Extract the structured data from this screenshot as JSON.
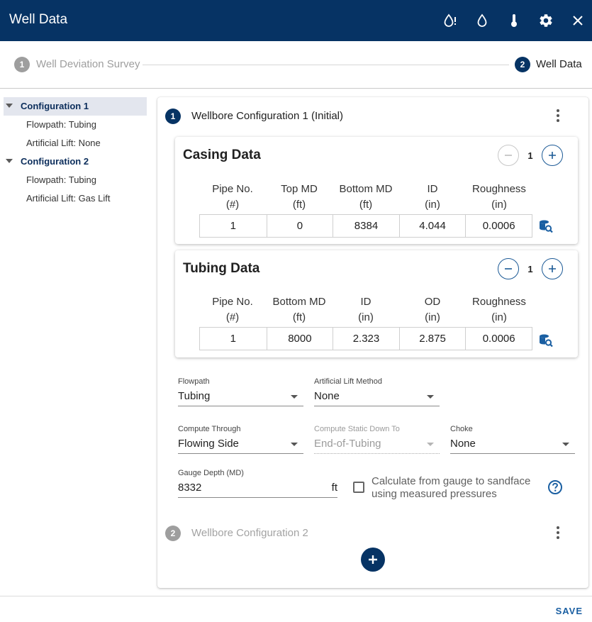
{
  "app": {
    "title": "Well Data",
    "header_icons": [
      "water-drop-alert-icon",
      "water-drop-icon",
      "thermometer-icon",
      "gear-icon",
      "close-icon"
    ]
  },
  "stepper": {
    "steps": [
      {
        "number": "1",
        "label": "Well Deviation Survey",
        "state": "inactive"
      },
      {
        "number": "2",
        "label": "Well Data",
        "state": "active"
      }
    ]
  },
  "sidebar": {
    "configs": [
      {
        "label": "Configuration 1",
        "children": [
          "Flowpath: Tubing",
          "Artificial Lift: None"
        ]
      },
      {
        "label": "Configuration 2",
        "children": [
          "Flowpath: Tubing",
          "Artificial Lift: Gas Lift"
        ]
      }
    ]
  },
  "wellbore1": {
    "number": "1",
    "title": "Wellbore Configuration 1 (Initial)",
    "casing": {
      "title": "Casing Data",
      "count": "1",
      "headers": [
        [
          "Pipe No.",
          "(#)"
        ],
        [
          "Top MD",
          "(ft)"
        ],
        [
          "Bottom MD",
          "(ft)"
        ],
        [
          "ID",
          "(in)"
        ],
        [
          "Roughness",
          "(in)"
        ]
      ],
      "row": [
        "1",
        "0",
        "8384",
        "4.044",
        "0.0006"
      ]
    },
    "tubing": {
      "title": "Tubing Data",
      "count": "1",
      "headers": [
        [
          "Pipe No.",
          "(#)"
        ],
        [
          "Bottom MD",
          "(ft)"
        ],
        [
          "ID",
          "(in)"
        ],
        [
          "OD",
          "(in)"
        ],
        [
          "Roughness",
          "(in)"
        ]
      ],
      "row": [
        "1",
        "8000",
        "2.323",
        "2.875",
        "0.0006"
      ]
    },
    "form": {
      "flowpath": {
        "label": "Flowpath",
        "value": "Tubing"
      },
      "lift": {
        "label": "Artificial Lift Method",
        "value": "None"
      },
      "compute": {
        "label": "Compute Through",
        "value": "Flowing Side"
      },
      "static": {
        "label": "Compute Static Down To",
        "value": "End-of-Tubing"
      },
      "choke": {
        "label": "Choke",
        "value": "None"
      },
      "gauge": {
        "label": "Gauge Depth (MD)",
        "value": "8332",
        "unit": "ft"
      },
      "calc_line1": "Calculate from gauge to sandface",
      "calc_line2": "using measured pressures"
    }
  },
  "wellbore2": {
    "number": "2",
    "title": "Wellbore Configuration 2"
  },
  "footer": {
    "save_label": "SAVE"
  },
  "colors": {
    "primary": "#063364",
    "accent": "#1a5fa2",
    "inactive_step": "#9e9e9e",
    "selected_bg": "#e3e6ee"
  }
}
